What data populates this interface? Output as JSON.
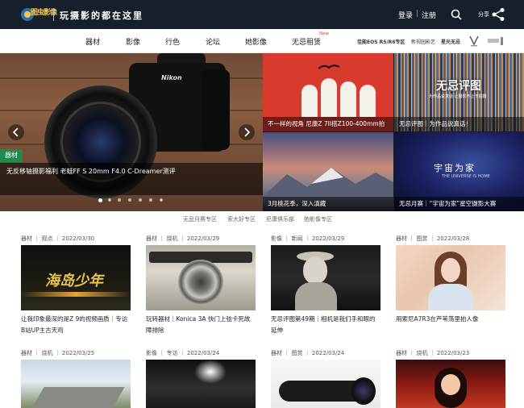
{
  "header": {
    "logo_text": "图虫影像",
    "slogan": "玩摄影的都在这里",
    "login": "登录",
    "divider": "|",
    "register": "注册",
    "share": "分享"
  },
  "nav": {
    "items": [
      "器材",
      "影像",
      "行色",
      "论坛",
      "她影像",
      "无忌租赁"
    ],
    "new_badge": "New",
    "right_links": [
      "佳能EOS R5/R6专区",
      "新视园影艺",
      "星光无忌"
    ]
  },
  "hero": {
    "tag": "器材",
    "caption": "无反移轴摄影福利 老蛙FF S 20mm F4.0 C-Dreamer测评",
    "camera_brand": "Nikon",
    "dots_count": 7,
    "active_dot": 1
  },
  "tiles": [
    {
      "caption": "不一样的视角 尼康Z 7II搭Z100-400mm拍"
    },
    {
      "caption": "无忌评图｜为作品说真话！",
      "overlay_title": "无忌评图",
      "overlay_sub": "为作品说真话 让摄影不止于拍摄"
    },
    {
      "caption": "3月桃花季，深入滇藏"
    },
    {
      "caption": "无忌月赛｜“宇宙为家”星空摄影大赛",
      "overlay_title": "宇宙为家",
      "overlay_sub": "THE UNIVERSE IS HOME"
    }
  ],
  "subnav": [
    "无忌月赛专区",
    "索大好专区",
    "尼康俱乐部",
    "她影像专区"
  ],
  "cards_row1": [
    {
      "meta": "器材 ｜ 观点 ｜ 2022/03/30",
      "title": "让我印象最深的是Z 9的视频画质｜专访B站UP主古天鸡",
      "img_text": "海岛少年"
    },
    {
      "meta": "器材 ｜ 烧机 ｜ 2022/03/29",
      "title": "玩转器材｜Konica 3A 快门上弦卡死故障排除"
    },
    {
      "meta": "影像 ｜ 新闻 ｜ 2022/03/29",
      "title": "无忌评图第49期｜相机是我们手和眼的延伸"
    },
    {
      "meta": "器材 ｜ 图赏 ｜ 2022/03/28",
      "title": "用索尼A7R3在芦苇荡里拍人像"
    }
  ],
  "cards_row2": [
    {
      "meta": "器材 ｜ 烧机 ｜ 2022/03/25"
    },
    {
      "meta": "影像 ｜ 专访 ｜ 2022/03/24"
    },
    {
      "meta": "器材 ｜ 图赏 ｜ 2022/03/24"
    },
    {
      "meta": "器材 ｜ 烧机 ｜ 2022/03/23"
    }
  ],
  "colors": {
    "header_bg": "#16202a",
    "hero_tag_green": "#1f8a4c",
    "new_badge_red": "#e23a3a"
  }
}
